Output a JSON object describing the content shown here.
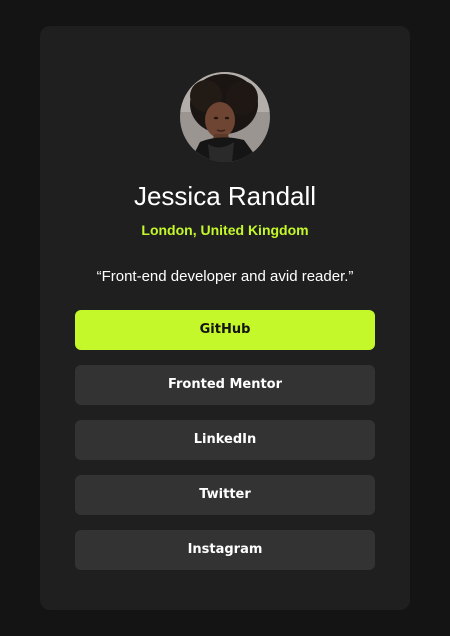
{
  "profile": {
    "name": "Jessica Randall",
    "location": "London, United Kingdom",
    "bio": "“Front-end developer and avid reader.”"
  },
  "links": [
    {
      "label": "GitHub",
      "active": true
    },
    {
      "label": "Fronted Mentor",
      "active": false
    },
    {
      "label": "LinkedIn",
      "active": false
    },
    {
      "label": "Twitter",
      "active": false
    },
    {
      "label": "Instagram",
      "active": false
    }
  ],
  "colors": {
    "page_background": "#141414",
    "card_background": "#1f1f1f",
    "accent": "#c4f82a",
    "button_background": "#333333",
    "text": "#ffffff"
  }
}
